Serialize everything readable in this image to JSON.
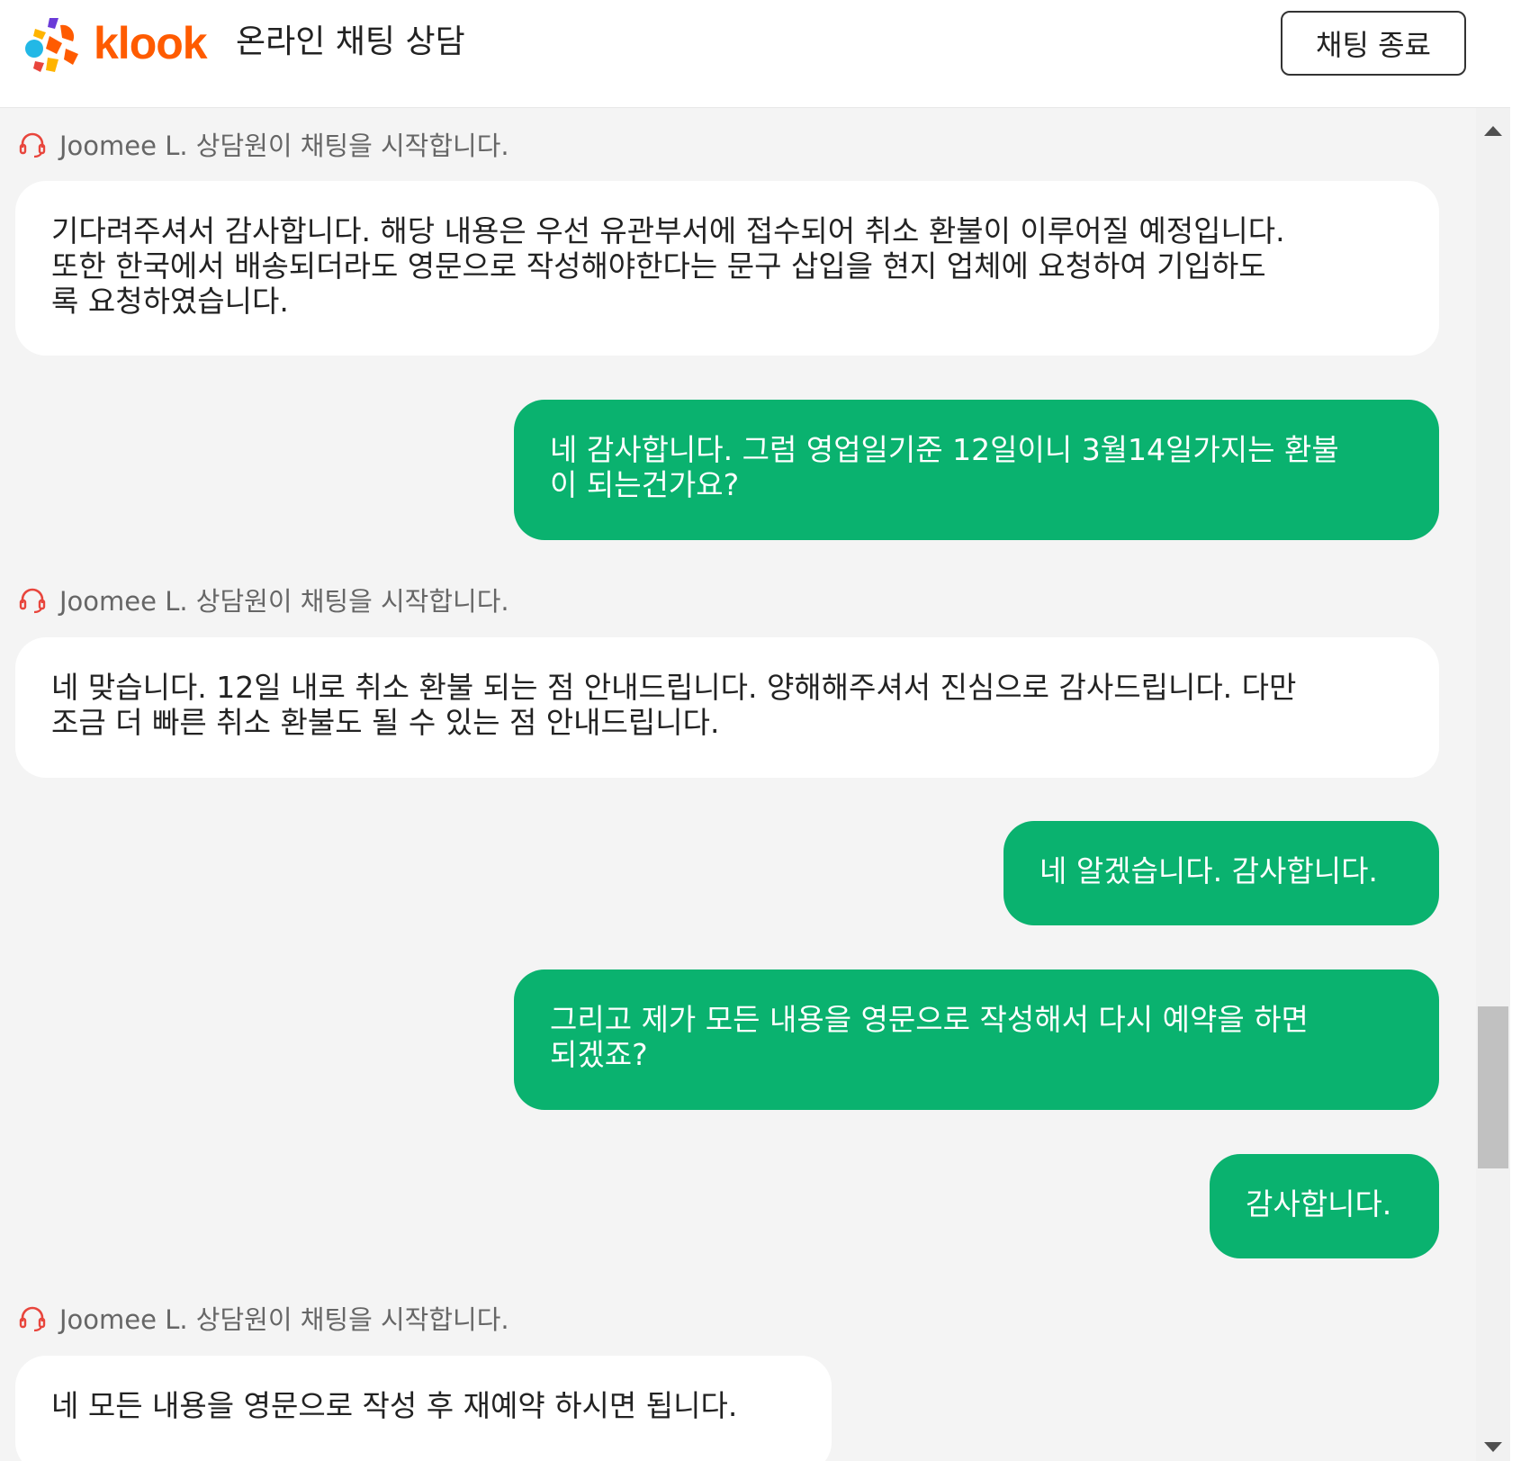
{
  "header": {
    "brand": "klook",
    "title": "온라인 채팅 상담",
    "end_chat_label": "채팅 종료"
  },
  "colors": {
    "brand_orange": "#ff5b00",
    "user_bubble": "#0ab26f",
    "agent_icon": "#e8453c",
    "chat_background": "#f4f4f4"
  },
  "messages": [
    {
      "type": "agent_notice",
      "text": "Joomee L. 상담원이 채팅을 시작합니다."
    },
    {
      "type": "agent",
      "lines": [
        "기다려주셔서 감사합니다. 해당 내용은 우선 유관부서에 접수되어 취소 환불이 이루어질 예정입니다.",
        "또한 한국에서 배송되더라도 영문으로 작성해야한다는 문구 삽입을 현지 업체에 요청하여 기입하도",
        "록 요청하였습니다."
      ]
    },
    {
      "type": "user",
      "lines": [
        "네 감사합니다. 그럼 영업일기준 12일이니 3월14일가지는 환불",
        "이 되는건가요?"
      ]
    },
    {
      "type": "agent_notice",
      "text": "Joomee L. 상담원이 채팅을 시작합니다."
    },
    {
      "type": "agent",
      "lines": [
        "네 맞습니다. 12일 내로 취소 환불 되는 점 안내드립니다. 양해해주셔서 진심으로 감사드립니다. 다만",
        "조금 더 빠른 취소 환불도 될 수 있는 점 안내드립니다."
      ]
    },
    {
      "type": "user",
      "lines": [
        "네 알겠습니다. 감사합니다."
      ]
    },
    {
      "type": "user",
      "lines": [
        "그리고 제가 모든 내용을 영문으로 작성해서 다시 예약을 하면",
        "되겠죠?"
      ]
    },
    {
      "type": "user",
      "lines": [
        "감사합니다."
      ]
    },
    {
      "type": "agent_notice",
      "text": "Joomee L. 상담원이 채팅을 시작합니다."
    },
    {
      "type": "agent",
      "lines": [
        "네 모든 내용을 영문으로 작성 후 재예약 하시면 됩니다."
      ]
    }
  ]
}
